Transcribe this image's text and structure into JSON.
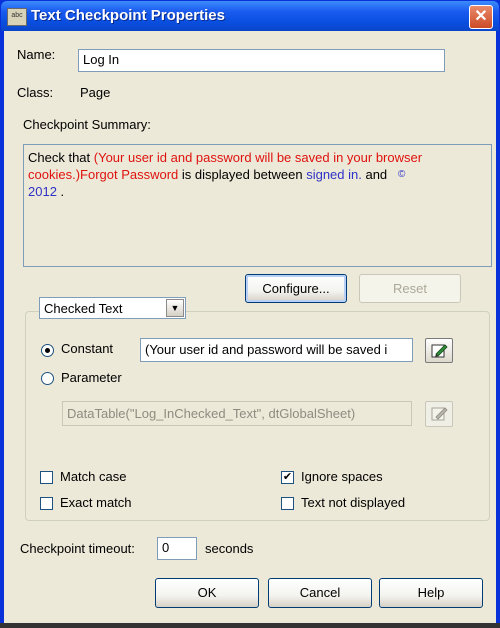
{
  "window": {
    "title": "Text Checkpoint Properties",
    "icon_text": "abc",
    "close_glyph": "✕"
  },
  "name_field": {
    "label": "Name:",
    "value": "Log In"
  },
  "class_field": {
    "label": "Class:",
    "value": "Page"
  },
  "summary": {
    "label": "Checkpoint Summary:",
    "prefix": "Check that ",
    "checked_text": "(Your user id and password will be saved in your browser cookies.)Forgot Password",
    "middle": " is displayed between ",
    "before_text": "signed in.",
    "and": " and ",
    "after_symbol": "©",
    "after_year": "2012",
    "end": " ."
  },
  "buttons": {
    "configure": "Configure...",
    "reset": "Reset",
    "ok": "OK",
    "cancel": "Cancel",
    "help": "Help"
  },
  "dropdown": {
    "selected": "Checked Text",
    "arrow": "▼"
  },
  "constant": {
    "label": "Constant",
    "selected": true,
    "value": "(Your user id and password will be saved i"
  },
  "parameter": {
    "label": "Parameter",
    "selected": false,
    "value": "DataTable(\"Log_InChecked_Text\", dtGlobalSheet)"
  },
  "options": {
    "match_case": {
      "label": "Match case",
      "checked": false
    },
    "ignore_spaces": {
      "label": "Ignore spaces",
      "checked": true,
      "mark": "✔"
    },
    "exact_match": {
      "label": "Exact match",
      "checked": false
    },
    "text_not_displayed": {
      "label": "Text not displayed",
      "checked": false
    }
  },
  "timeout": {
    "label": "Checkpoint timeout:",
    "value": "0",
    "unit": "seconds"
  },
  "icons": {
    "edit_icon": "pencil-edit-icon"
  },
  "colors": {
    "title_bar": "#0a4fe0",
    "checked_text": "#e0120e",
    "boundary_text": "#2f32c8",
    "dialog_bg": "#ece9d8"
  }
}
